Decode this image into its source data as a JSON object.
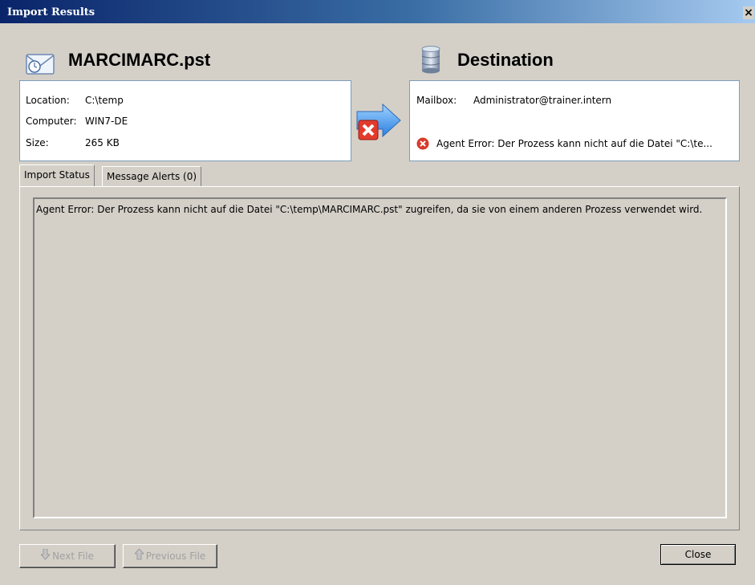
{
  "window": {
    "title": "Import Results",
    "close_glyph": "×"
  },
  "source": {
    "name": "MARCIMARC.pst",
    "icon": "pst-envelope-icon",
    "fields": [
      {
        "label": "Location:",
        "value": "C:\\temp"
      },
      {
        "label": "Computer:",
        "value": "WIN7-DE"
      },
      {
        "label": "Size:",
        "value": "265 KB"
      }
    ]
  },
  "transfer": {
    "icon": "transfer-arrow-error-icon"
  },
  "destination": {
    "name": "Destination",
    "icon": "database-icon",
    "mailbox_label": "Mailbox:",
    "mailbox_value": "Administrator@trainer.intern",
    "error_text": "Agent Error: Der Prozess kann nicht auf die Datei \"C:\\te..."
  },
  "tabs": [
    {
      "label": "Import Status",
      "active": true
    },
    {
      "label": "Message Alerts (0)",
      "active": false
    }
  ],
  "status_text": "Agent Error: Der Prozess kann nicht auf die Datei \"C:\\temp\\MARCIMARC.pst\" zugreifen, da sie von einem anderen Prozess verwendet wird.",
  "buttons": {
    "next": "Next File",
    "previous": "Previous File",
    "close": "Close"
  },
  "colors": {
    "titlebar": "#0a246a",
    "arrow": "#3a8ee6",
    "error": "#d83a2a"
  }
}
